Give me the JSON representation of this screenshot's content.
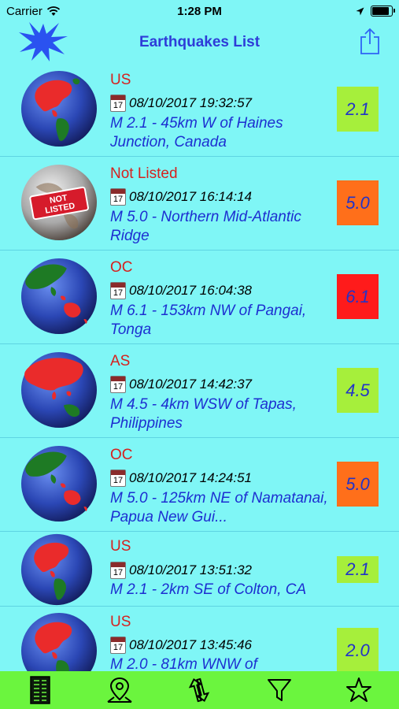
{
  "status_bar": {
    "carrier": "Carrier",
    "time": "1:28 PM"
  },
  "nav": {
    "title": "Earthquakes List"
  },
  "earthquakes": [
    {
      "region": "US",
      "date": "08/10/2017 19:32:57",
      "title": "M 2.1 - 45km W of Haines Junction, Canada",
      "magnitude": "2.1",
      "mag_color": "#a6ef3b",
      "globe": "americas"
    },
    {
      "region": "Not Listed",
      "date": "08/10/2017 16:14:14",
      "title": "M 5.0 - Northern Mid-Atlantic Ridge",
      "magnitude": "5.0",
      "mag_color": "#ff6f1a",
      "globe": "not-listed"
    },
    {
      "region": "OC",
      "date": "08/10/2017 16:04:38",
      "title": "M 6.1 - 153km NW of Pangai, Tonga",
      "magnitude": "6.1",
      "mag_color": "#ff1b1b",
      "globe": "oceania"
    },
    {
      "region": "AS",
      "date": "08/10/2017 14:42:37",
      "title": "M 4.5 - 4km WSW of Tapas, Philippines",
      "magnitude": "4.5",
      "mag_color": "#a6ef3b",
      "globe": "asia"
    },
    {
      "region": "OC",
      "date": "08/10/2017 14:24:51",
      "title": "M 5.0 - 125km NE of Namatanai, Papua New Gui...",
      "magnitude": "5.0",
      "mag_color": "#ff6f1a",
      "globe": "oceania"
    },
    {
      "region": "US",
      "date": "08/10/2017 13:51:32",
      "title": "M 2.1 - 2km SE of Colton, CA",
      "magnitude": "2.1",
      "mag_color": "#a6ef3b",
      "globe": "americas"
    },
    {
      "region": "US",
      "date": "08/10/2017 13:45:46",
      "title": "M 2.0 - 81km WNW of",
      "magnitude": "2.0",
      "mag_color": "#a6ef3b",
      "globe": "americas"
    }
  ],
  "calendar_day": "17",
  "not_listed_sign": [
    "NOT",
    "LISTED"
  ],
  "tabs": [
    {
      "icon": "list-icon",
      "selected": true
    },
    {
      "icon": "map-pin-icon",
      "selected": false
    },
    {
      "icon": "sort-icon",
      "selected": false
    },
    {
      "icon": "filter-icon",
      "selected": false
    },
    {
      "icon": "star-icon",
      "selected": false
    }
  ]
}
